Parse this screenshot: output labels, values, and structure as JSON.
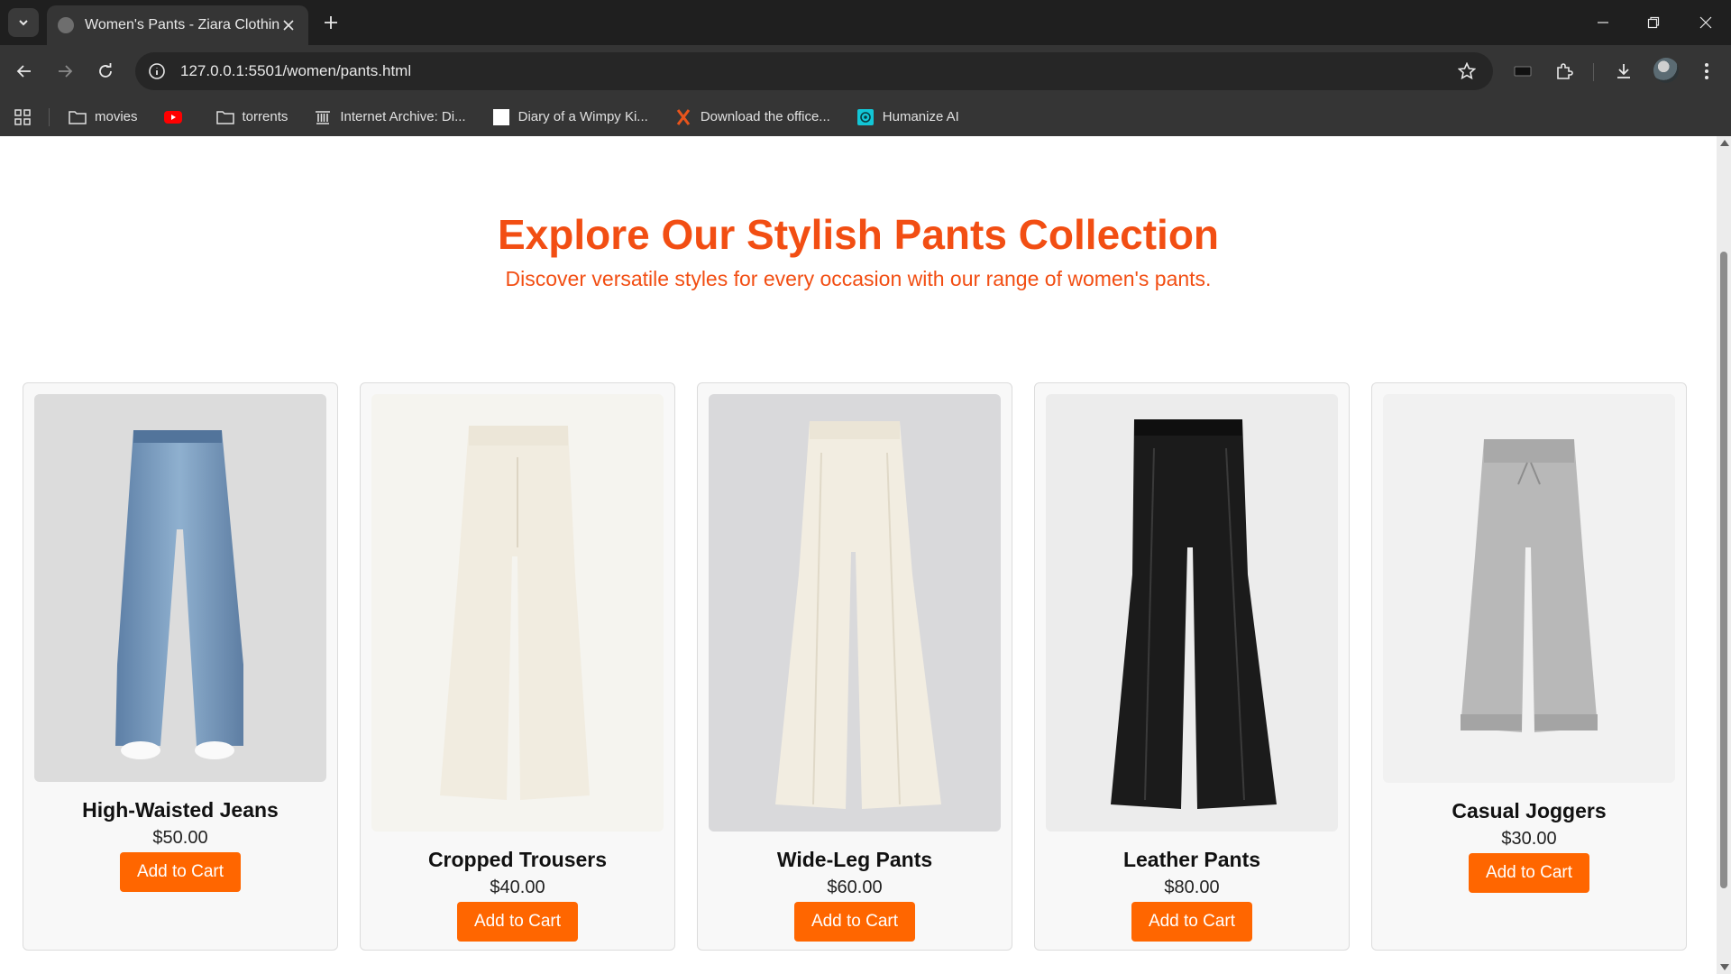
{
  "browser": {
    "tab_title": "Women's Pants - Ziara Clothing",
    "url": "127.0.0.1:5501/women/pants.html",
    "bookmarks": [
      {
        "label": "movies",
        "icon": "folder-icon"
      },
      {
        "label": "",
        "icon": "youtube-icon"
      },
      {
        "label": "torrents",
        "icon": "folder-icon"
      },
      {
        "label": "Internet Archive: Di...",
        "icon": "archive-icon"
      },
      {
        "label": "Diary of a Wimpy Ki...",
        "icon": "blank-page-icon"
      },
      {
        "label": "Download the office...",
        "icon": "x-logo-icon"
      },
      {
        "label": "Humanize AI",
        "icon": "humanize-icon"
      }
    ]
  },
  "hero": {
    "title": "Explore Our Stylish Pants Collection",
    "subtitle": "Discover versatile styles for every occasion with our range of women's pants."
  },
  "products": [
    {
      "name": "High-Waisted Jeans",
      "price": "$50.00",
      "button": "Add to Cart",
      "image": "denim-jeans"
    },
    {
      "name": "Cropped Trousers",
      "price": "$40.00",
      "button": "Add to Cart",
      "image": "cream-trousers"
    },
    {
      "name": "Wide-Leg Pants",
      "price": "$60.00",
      "button": "Add to Cart",
      "image": "ivory-wide-leg"
    },
    {
      "name": "Leather Pants",
      "price": "$80.00",
      "button": "Add to Cart",
      "image": "black-leather"
    },
    {
      "name": "Casual Joggers",
      "price": "$30.00",
      "button": "Add to Cart",
      "image": "grey-joggers"
    }
  ],
  "colors": {
    "accent": "#f24e13",
    "button": "#ff6600"
  }
}
